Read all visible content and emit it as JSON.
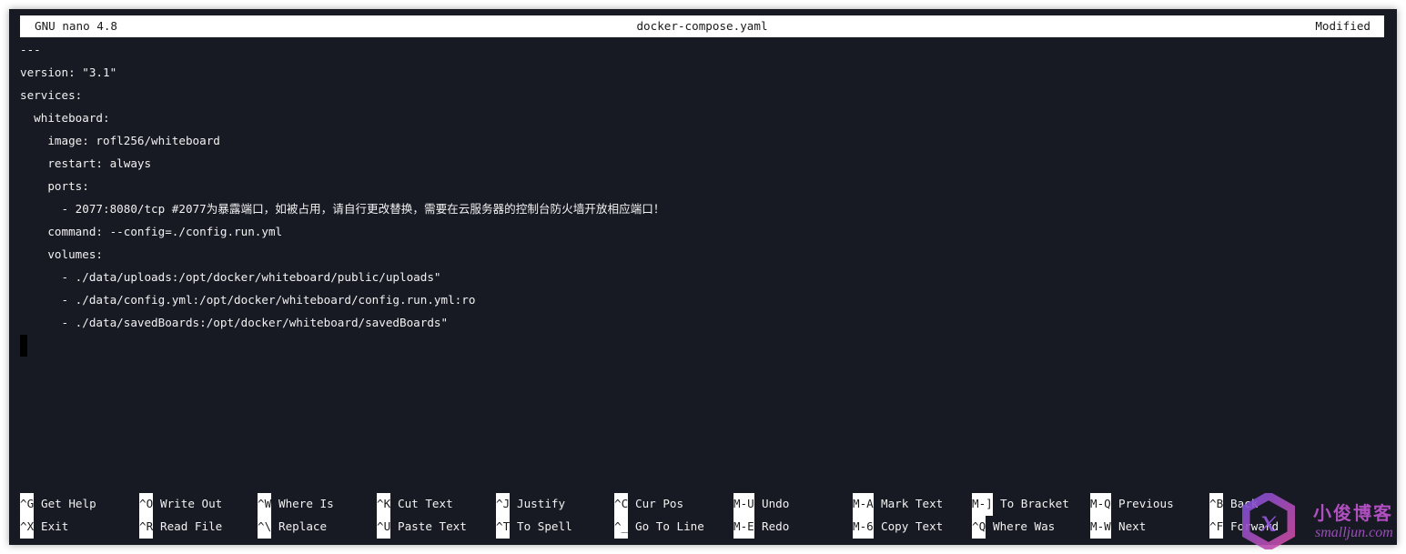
{
  "titlebar": {
    "app": "GNU nano 4.8",
    "filename": "docker-compose.yaml",
    "status": "Modified"
  },
  "editor": {
    "lines": [
      "---",
      "version: \"3.1\"",
      "services:",
      "  whiteboard:",
      "    image: rofl256/whiteboard",
      "    restart: always",
      "    ports:",
      "      - 2077:8080/tcp #2077为暴露端口，如被占用，请自行更改替换，需要在云服务器的控制台防火墙开放相应端口！",
      "    command: --config=./config.run.yml",
      "    volumes:",
      "      - ./data/uploads:/opt/docker/whiteboard/public/uploads\"",
      "      - ./data/config.yml:/opt/docker/whiteboard/config.run.yml:ro",
      "      - ./data/savedBoards:/opt/docker/whiteboard/savedBoards\""
    ],
    "cursor_line": 14
  },
  "shortcuts": {
    "row1": [
      {
        "key": "^G",
        "label": "Get Help"
      },
      {
        "key": "^O",
        "label": "Write Out"
      },
      {
        "key": "^W",
        "label": "Where Is"
      },
      {
        "key": "^K",
        "label": "Cut Text"
      },
      {
        "key": "^J",
        "label": "Justify"
      },
      {
        "key": "^C",
        "label": "Cur Pos"
      },
      {
        "key": "M-U",
        "label": "Undo"
      },
      {
        "key": "M-A",
        "label": "Mark Text"
      },
      {
        "key": "M-]",
        "label": "To Bracket"
      },
      {
        "key": "M-Q",
        "label": "Previous"
      },
      {
        "key": "^B",
        "label": "Back"
      }
    ],
    "row2": [
      {
        "key": "^X",
        "label": "Exit"
      },
      {
        "key": "^R",
        "label": "Read File"
      },
      {
        "key": "^\\",
        "label": "Replace"
      },
      {
        "key": "^U",
        "label": "Paste Text"
      },
      {
        "key": "^T",
        "label": "To Spell"
      },
      {
        "key": "^_",
        "label": "Go To Line"
      },
      {
        "key": "M-E",
        "label": "Redo"
      },
      {
        "key": "M-6",
        "label": "Copy Text"
      },
      {
        "key": "^Q",
        "label": "Where Was"
      },
      {
        "key": "M-W",
        "label": "Next"
      },
      {
        "key": "^F",
        "label": "Forward"
      }
    ]
  },
  "watermark": {
    "logo_letter": "x",
    "name_cn": "小俊博客",
    "domain": "smalljun.com"
  },
  "colors": {
    "terminal_bg": "#171923",
    "bar_bg": "#ffffff",
    "text": "#f2f2f2"
  }
}
